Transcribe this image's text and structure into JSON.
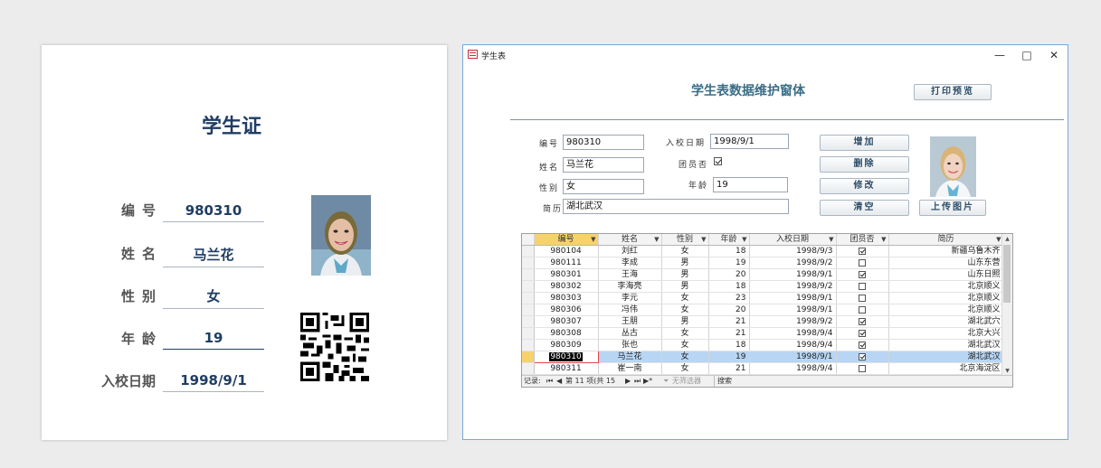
{
  "card": {
    "title": "学生证",
    "labels": {
      "id": "编号",
      "name": "姓名",
      "gender": "性别",
      "age": "年龄",
      "date": "入校日期"
    },
    "values": {
      "id": "980310",
      "name": "马兰花",
      "gender": "女",
      "age": "19",
      "date": "1998/9/1"
    }
  },
  "window": {
    "title": "学生表",
    "form_title": "学生表数据维护窗体",
    "buttons": {
      "print_preview": "打印预览",
      "add": "增加",
      "delete": "删除",
      "modify": "修改",
      "clear": "清空",
      "upload": "上传图片"
    },
    "fields": {
      "id_label": "编号",
      "id_value": "980310",
      "name_label": "姓名",
      "name_value": "马兰花",
      "gender_label": "性别",
      "gender_value": "女",
      "resume_label": "简历",
      "resume_value": "湖北武汉",
      "date_label": "入校日期",
      "date_value": "1998/9/1",
      "member_label": "团员否",
      "member_checked": true,
      "age_label": "年龄",
      "age_value": "19"
    },
    "table": {
      "headers": [
        "编号",
        "姓名",
        "性别",
        "年龄",
        "入校日期",
        "团员否",
        "简历"
      ],
      "rows": [
        {
          "id": "980104",
          "name": "刘红",
          "gender": "女",
          "age": "18",
          "date": "1998/9/3",
          "member": true,
          "resume": "新疆乌鲁木齐"
        },
        {
          "id": "980111",
          "name": "李成",
          "gender": "男",
          "age": "19",
          "date": "1998/9/2",
          "member": false,
          "resume": "山东东营"
        },
        {
          "id": "980301",
          "name": "王海",
          "gender": "男",
          "age": "20",
          "date": "1998/9/1",
          "member": true,
          "resume": "山东日照"
        },
        {
          "id": "980302",
          "name": "李海亮",
          "gender": "男",
          "age": "18",
          "date": "1998/9/2",
          "member": false,
          "resume": "北京顺义"
        },
        {
          "id": "980303",
          "name": "李元",
          "gender": "女",
          "age": "23",
          "date": "1998/9/1",
          "member": false,
          "resume": "北京顺义"
        },
        {
          "id": "980306",
          "name": "冯伟",
          "gender": "女",
          "age": "20",
          "date": "1998/9/1",
          "member": false,
          "resume": "北京顺义"
        },
        {
          "id": "980307",
          "name": "王朋",
          "gender": "男",
          "age": "21",
          "date": "1998/9/2",
          "member": true,
          "resume": "湖北武穴"
        },
        {
          "id": "980308",
          "name": "丛古",
          "gender": "女",
          "age": "21",
          "date": "1998/9/4",
          "member": true,
          "resume": "北京大兴"
        },
        {
          "id": "980309",
          "name": "张也",
          "gender": "女",
          "age": "18",
          "date": "1998/9/4",
          "member": true,
          "resume": "湖北武汉"
        },
        {
          "id": "980310",
          "name": "马兰花",
          "gender": "女",
          "age": "19",
          "date": "1998/9/1",
          "member": true,
          "resume": "湖北武汉"
        },
        {
          "id": "980311",
          "name": "崔一南",
          "gender": "女",
          "age": "21",
          "date": "1998/9/4",
          "member": false,
          "resume": "北京海淀区"
        }
      ],
      "current_row": 9
    },
    "navbar": {
      "record_label": "记录:",
      "position": "第 11 项(共 15",
      "filter": "无筛选器",
      "search": "搜索"
    }
  },
  "colors": {
    "card_title": "#1f3d64",
    "form_title": "#3a6d86",
    "selected_row": "#b8d6f3",
    "selected_header": "#f7d26c"
  }
}
